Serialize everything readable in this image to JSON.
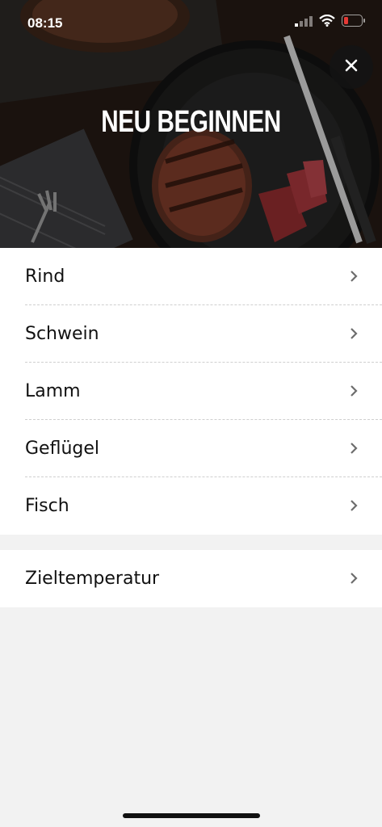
{
  "status": {
    "time": "08:15"
  },
  "header": {
    "title": "NEU BEGINNEN"
  },
  "menu": {
    "items": [
      {
        "label": "Rind"
      },
      {
        "label": "Schwein"
      },
      {
        "label": "Lamm"
      },
      {
        "label": "Geflügel"
      },
      {
        "label": "Fisch"
      }
    ]
  },
  "secondary": {
    "items": [
      {
        "label": "Zieltemperatur"
      }
    ]
  },
  "icons": {
    "close": "close-icon",
    "chevron": "chevron-right-icon",
    "signal": "cellular-signal-icon",
    "wifi": "wifi-icon",
    "battery": "battery-low-icon"
  },
  "colors": {
    "battery_low": "#e53935",
    "chevron": "#6d6d6d",
    "background": "#f2f2f2"
  }
}
